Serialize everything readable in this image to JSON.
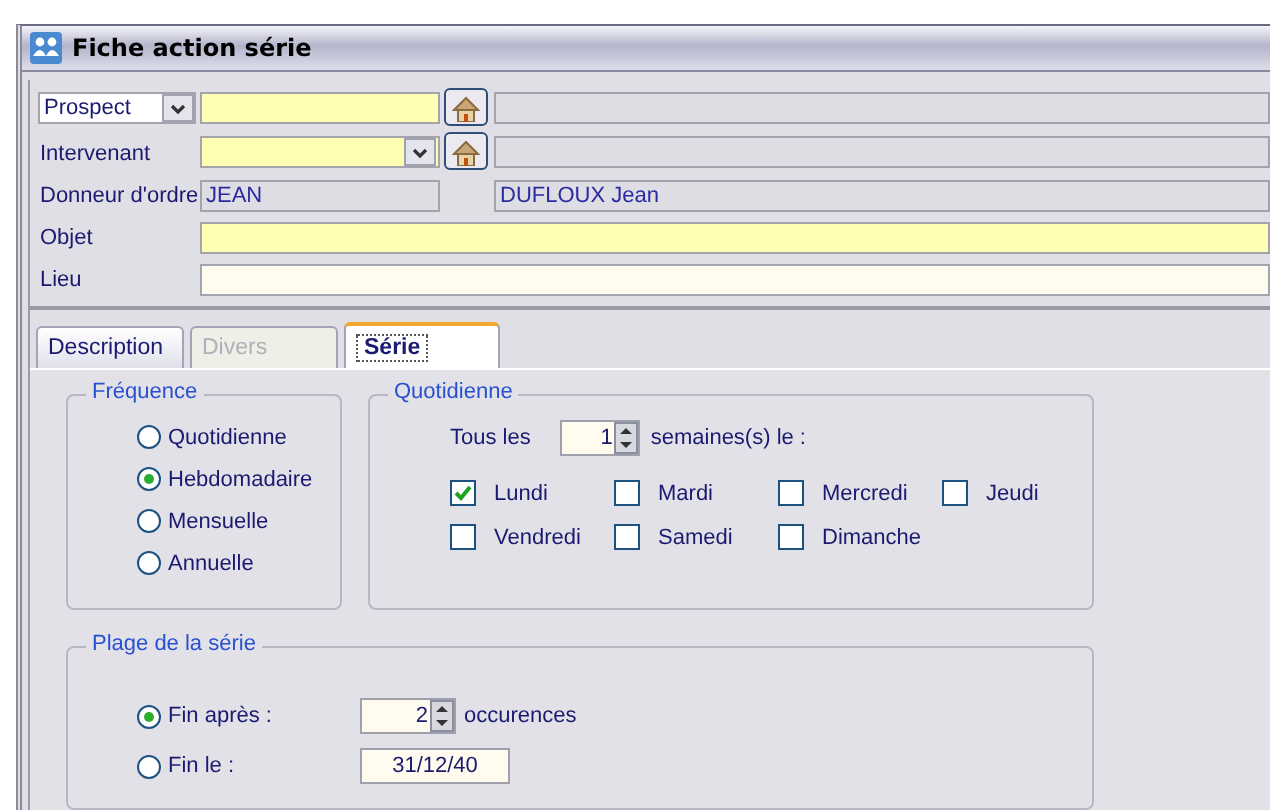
{
  "window": {
    "title": "Fiche action série"
  },
  "prospect": {
    "type": "Prospect"
  },
  "intervenant": {
    "label": "Intervenant"
  },
  "donneur": {
    "label": "Donneur d'ordre",
    "code": "JEAN",
    "name": "DUFLOUX Jean"
  },
  "objet": {
    "label": "Objet"
  },
  "lieu": {
    "label": "Lieu"
  },
  "tabs": [
    {
      "label": "Description",
      "selected": false,
      "disabled": false
    },
    {
      "label": "Divers",
      "selected": false,
      "disabled": true
    },
    {
      "label": "Série",
      "selected": true,
      "disabled": false
    }
  ],
  "frequence": {
    "title": "Fréquence",
    "options": [
      {
        "label": "Quotidienne",
        "selected": false
      },
      {
        "label": "Hebdomadaire",
        "selected": true
      },
      {
        "label": "Mensuelle",
        "selected": false
      },
      {
        "label": "Annuelle",
        "selected": false
      }
    ]
  },
  "quotidienne": {
    "title": "Quotidienne",
    "prefix": "Tous les",
    "count": "1",
    "suffix": "semaines(s) le :",
    "days": [
      {
        "label": "Lundi",
        "checked": true
      },
      {
        "label": "Mardi",
        "checked": false
      },
      {
        "label": "Mercredi",
        "checked": false
      },
      {
        "label": "Jeudi",
        "checked": false
      },
      {
        "label": "Vendredi",
        "checked": false
      },
      {
        "label": "Samedi",
        "checked": false
      },
      {
        "label": "Dimanche",
        "checked": false
      }
    ]
  },
  "plage": {
    "title": "Plage de la série",
    "options": [
      {
        "kind": "spinner",
        "label": "Fin après :",
        "selected": true,
        "value": "2",
        "suffix": "occurences"
      },
      {
        "kind": "date",
        "label": "Fin le :",
        "selected": false,
        "value": "31/12/40"
      }
    ]
  }
}
